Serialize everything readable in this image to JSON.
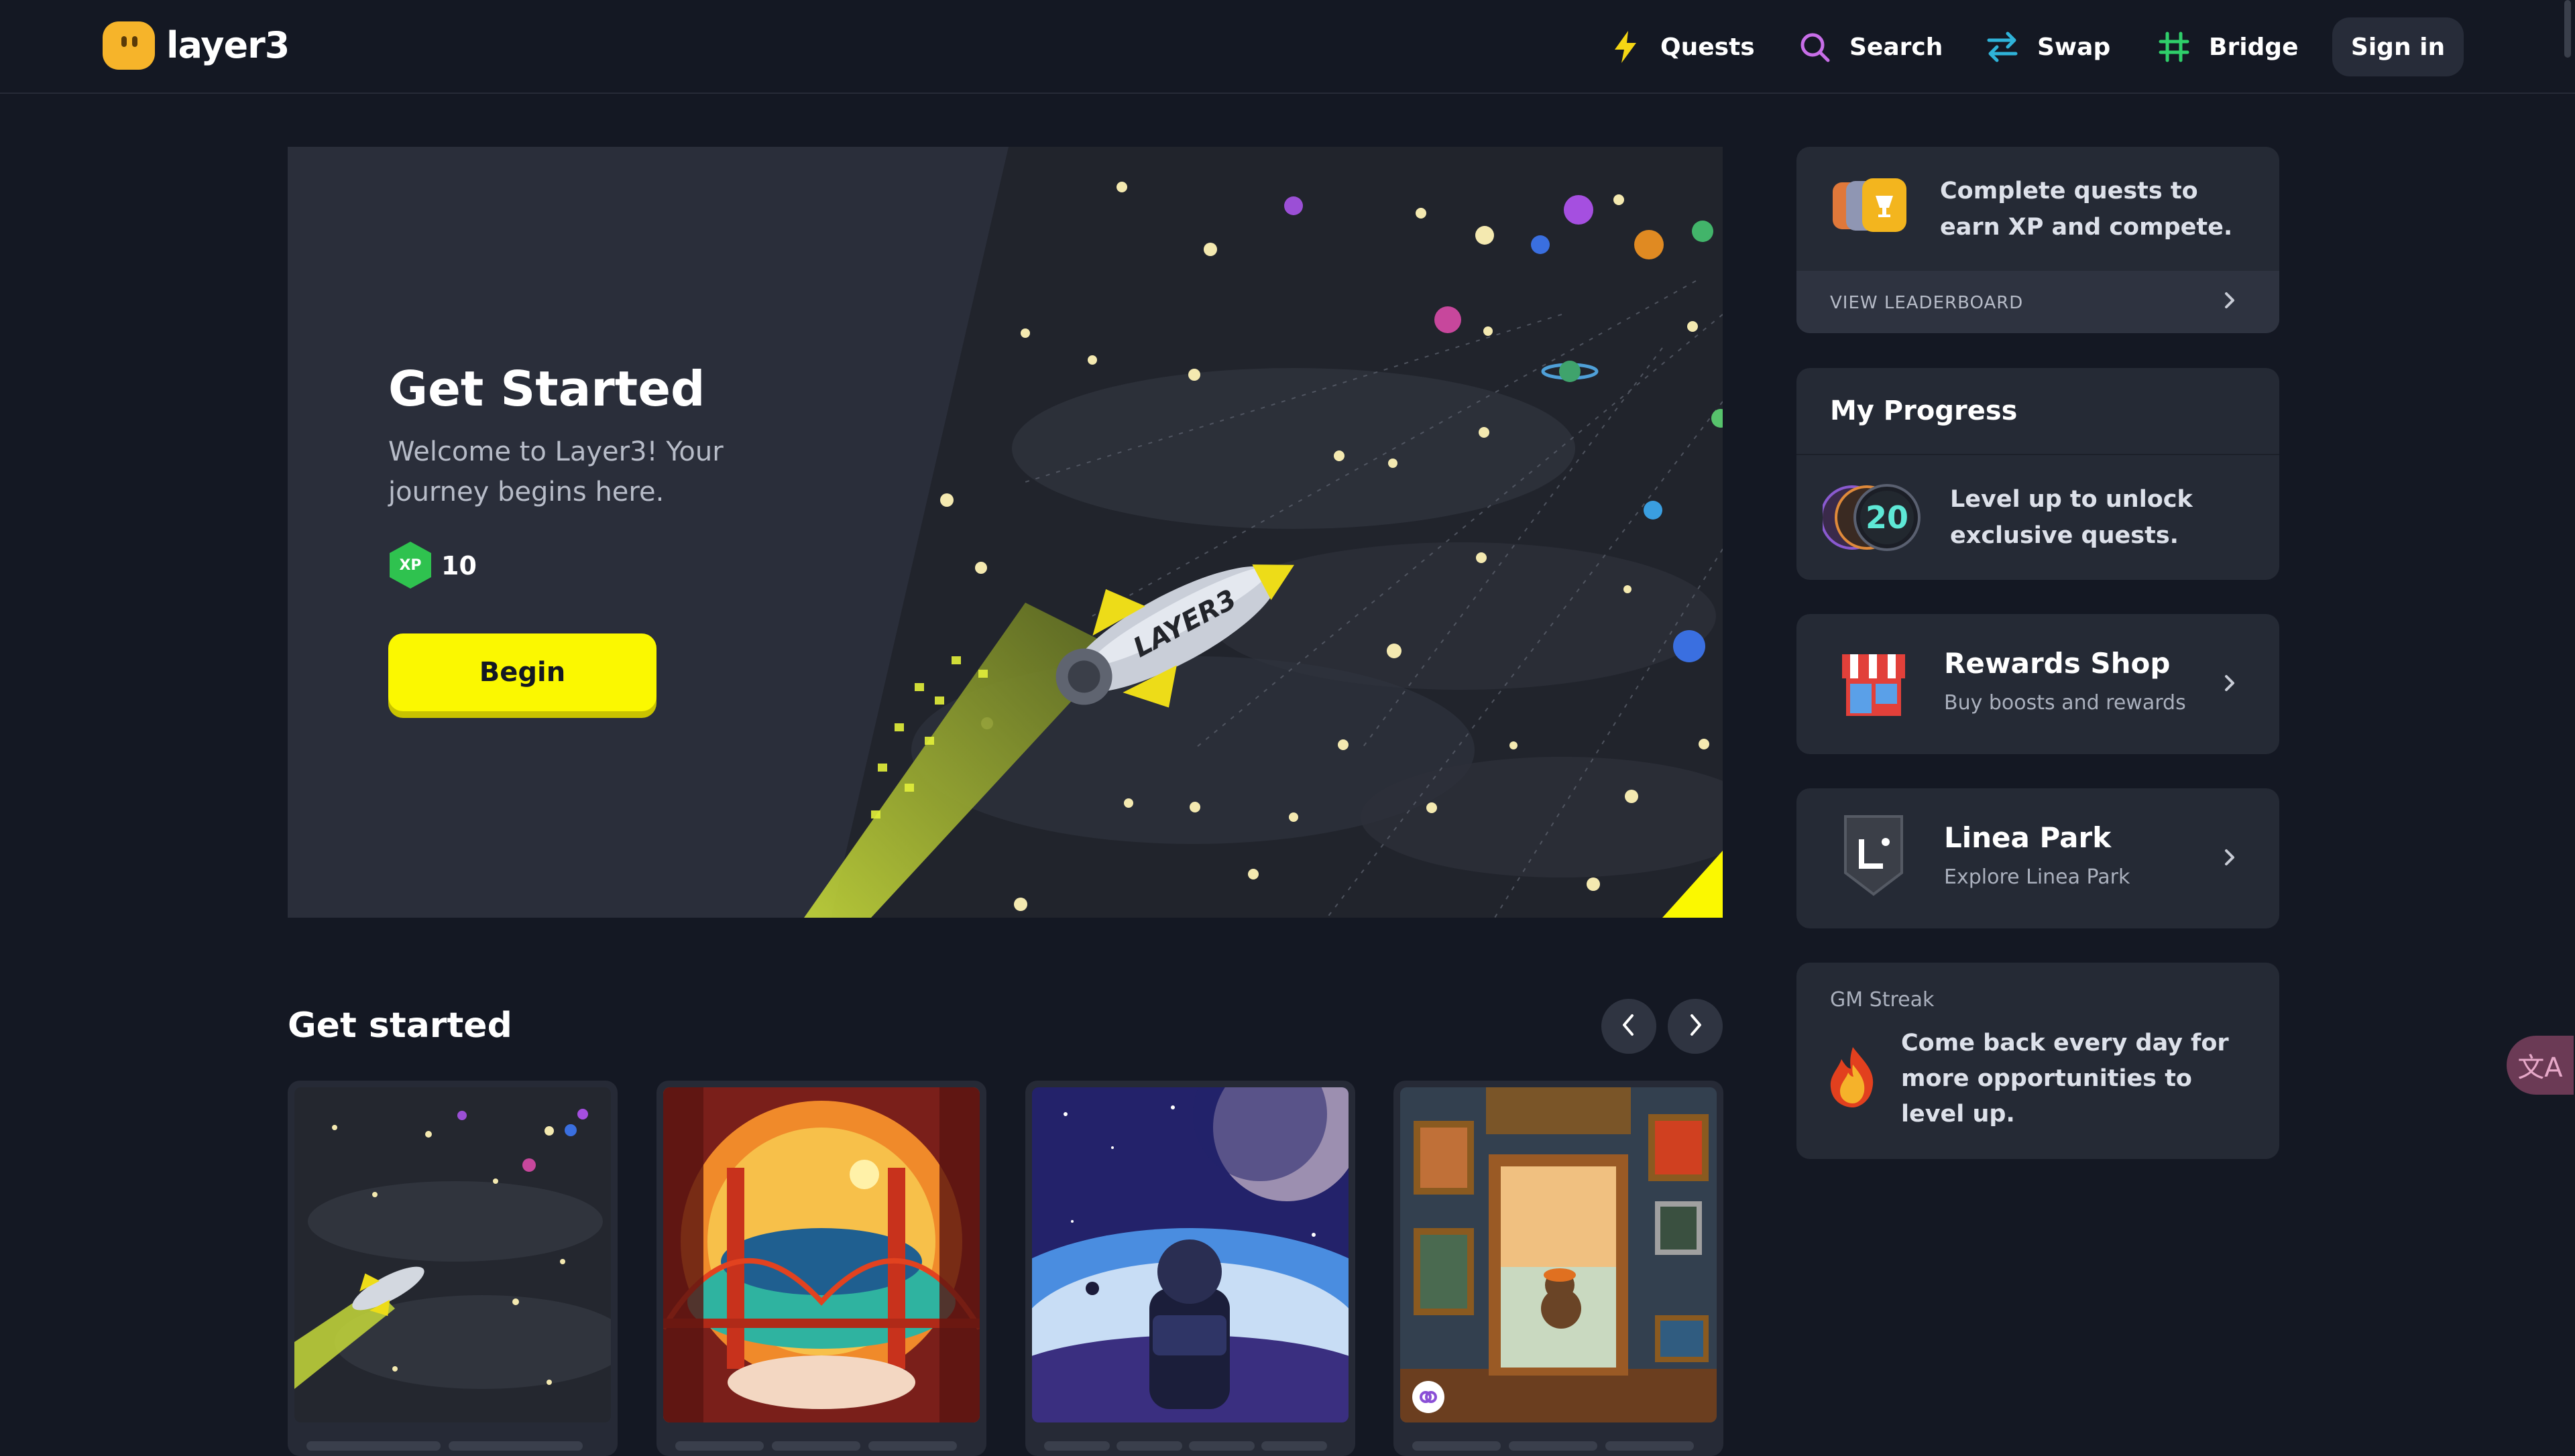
{
  "app": {
    "name": "layer3"
  },
  "nav": {
    "items": [
      {
        "label": "Quests",
        "icon": "lightning-icon"
      },
      {
        "label": "Search",
        "icon": "search-icon"
      },
      {
        "label": "Swap",
        "icon": "swap-icon"
      },
      {
        "label": "Bridge",
        "icon": "bridge-icon"
      }
    ],
    "signin_label": "Sign in"
  },
  "hero": {
    "title": "Get Started",
    "subtitle": "Welcome to Layer3! Your journey begins here.",
    "xp_badge": "XP",
    "xp_value": "10",
    "button_label": "Begin",
    "rocket_text": "LAYER3"
  },
  "section": {
    "title": "Get started"
  },
  "cards": [
    {
      "image": "rocket-space-image"
    },
    {
      "image": "golden-gate-bridge-image"
    },
    {
      "image": "astronaut-planet-image"
    },
    {
      "image": "monkey-gallery-image"
    }
  ],
  "leaderboard": {
    "text": "Complete quests to earn XP and compete.",
    "link_label": "VIEW LEADERBOARD"
  },
  "progress": {
    "title": "My Progress",
    "level_badge": "20",
    "text": "Level up to unlock exclusive quests."
  },
  "rewards_shop": {
    "title": "Rewards Shop",
    "subtitle": "Buy boosts and rewards"
  },
  "linea_park": {
    "title": "Linea Park",
    "subtitle": "Explore Linea Park"
  },
  "gm_streak": {
    "label": "GM Streak",
    "text": "Come back every day for more opportunities to level up."
  },
  "translate_widget": {
    "label": "文A"
  },
  "colors": {
    "background": "#141823",
    "panel": "#252a35",
    "accent_yellow": "#fbf800",
    "xp_green": "#2fc24f",
    "quests_icon": "#f5d614",
    "search_icon": "#c86ee8",
    "swap_icon": "#2fb3d9",
    "bridge_icon": "#2fcf6a"
  }
}
